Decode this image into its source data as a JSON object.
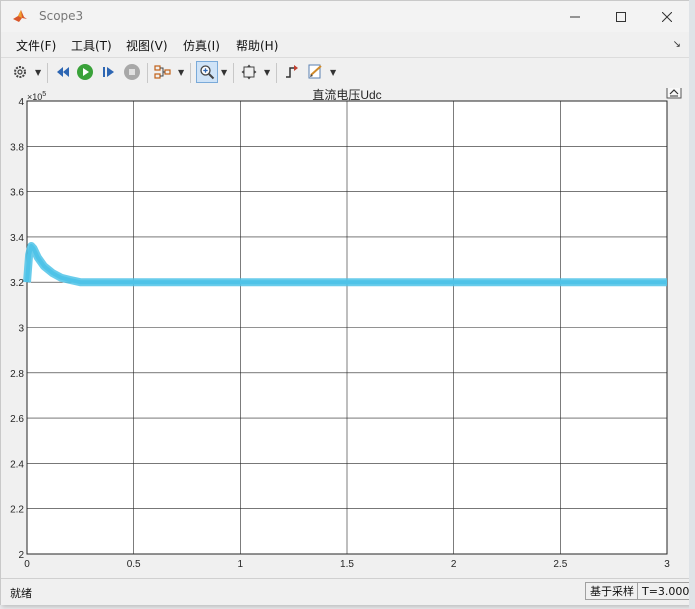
{
  "window": {
    "title": "Scope3"
  },
  "menu": {
    "items": [
      "文件(F)",
      "工具(T)",
      "视图(V)",
      "仿真(I)",
      "帮助(H)"
    ]
  },
  "toolbar": {
    "icons": [
      "gear-icon",
      "rewind-icon",
      "run-icon",
      "step-forward-icon",
      "stop-icon",
      "highlight-icon",
      "zoom-in-icon",
      "fit-to-view-icon",
      "trigger-icon",
      "edit-icon"
    ]
  },
  "plot": {
    "title": "直流电压Udc",
    "exponent_base": "×10",
    "exponent_power": "5",
    "line_color": "#4fc3e8"
  },
  "chart_data": {
    "type": "line",
    "title": "直流电压Udc",
    "xlabel": "",
    "ylabel": "",
    "xlim": [
      0,
      3
    ],
    "ylim": [
      2,
      4
    ],
    "y_multiplier": 100000,
    "grid": true,
    "x_ticks": [
      "0",
      "0.5",
      "1",
      "1.5",
      "2",
      "2.5",
      "3"
    ],
    "y_ticks": [
      "2",
      "2.2",
      "2.4",
      "2.6",
      "2.8",
      "3",
      "3.2",
      "3.4",
      "3.6",
      "3.8",
      "4"
    ],
    "series": [
      {
        "x": [
          0,
          0.01,
          0.02,
          0.03,
          0.05,
          0.08,
          0.12,
          0.16,
          0.2,
          0.25,
          0.3,
          0.4,
          0.5,
          1.0,
          1.5,
          2.0,
          2.5,
          3.0
        ],
        "y": [
          3.2,
          3.32,
          3.36,
          3.35,
          3.31,
          3.27,
          3.24,
          3.22,
          3.21,
          3.2,
          3.2,
          3.2,
          3.2,
          3.2,
          3.2,
          3.2,
          3.2,
          3.2
        ]
      }
    ]
  },
  "status": {
    "left": "就绪",
    "mode": "基于采样",
    "time": "T=3.000"
  }
}
